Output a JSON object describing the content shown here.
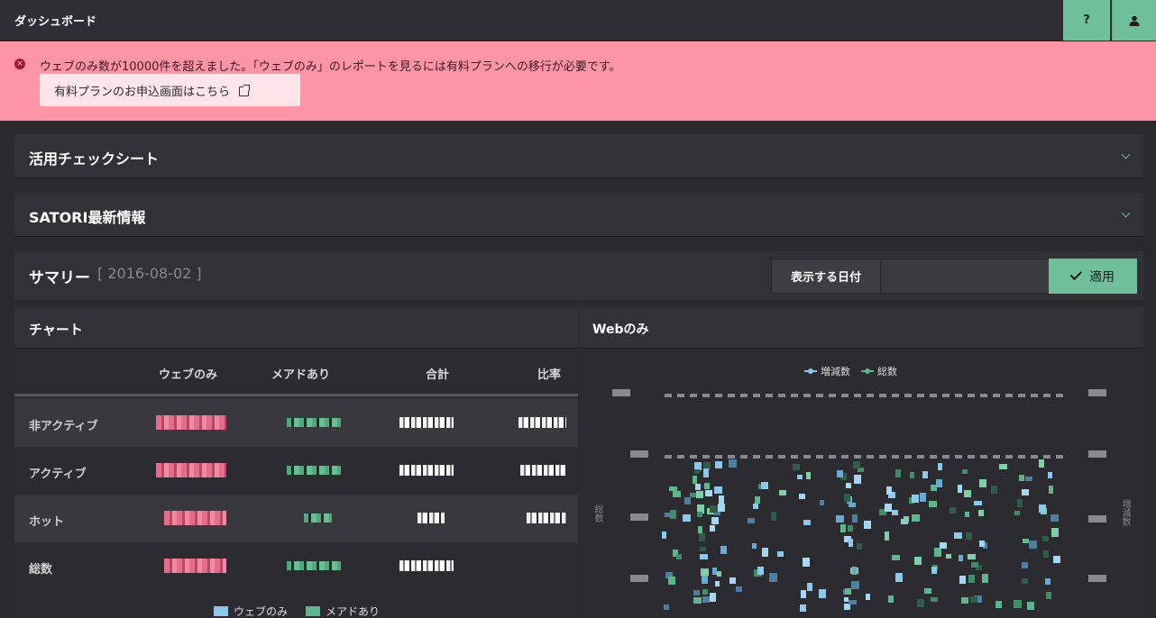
{
  "topbar": {
    "title": "ダッシュボード",
    "help_label": "?"
  },
  "alert": {
    "message": "ウェブのみ数が10000件を超えました。「ウェブのみ」のレポートを見るには有料プランへの移行が必要です。",
    "link_label": "有料プランのお申込画面はこちら"
  },
  "panels": {
    "checksheet": "活用チェックシート",
    "news": "SATORI最新情報"
  },
  "summary": {
    "title": "サマリー",
    "date": "[ 2016-08-02 ]",
    "date_label": "表示する日付",
    "date_value": "",
    "apply_label": "適用"
  },
  "chart": {
    "title": "チャート",
    "columns": [
      "ウェブのみ",
      "メアドあり",
      "合計",
      "比率"
    ],
    "rows": [
      "非アクティブ",
      "アクティブ",
      "ホット",
      "総数"
    ],
    "legend": [
      "ウェブのみ",
      "メアドあり"
    ]
  },
  "web": {
    "title": "Webのみ",
    "legend": [
      "増減数",
      "総数"
    ],
    "ylabel_left": "総数",
    "ylabel_right": "増減数"
  },
  "colors": {
    "accent": "#6fbf9a",
    "alert_bg": "#fe95a6",
    "series_web": "#8cc8ec",
    "series_mail": "#5fb58c"
  }
}
